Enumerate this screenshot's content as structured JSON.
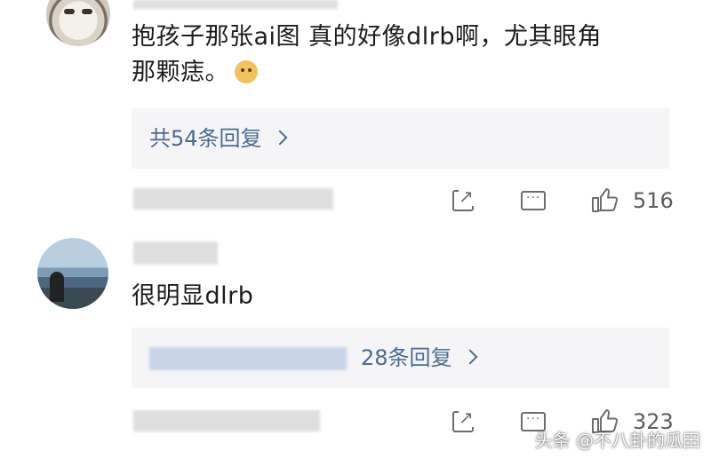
{
  "comments": [
    {
      "text": "抱孩子那张ai图 真的好像dlrb啊，尤其眼角",
      "text_line2": "那颗痣。",
      "emoji": "dog-emoji",
      "replies_label": "共54条回复",
      "like_count": "516"
    },
    {
      "text": "很明显dlrb",
      "replies_label": "28条回复",
      "like_count": "323"
    }
  ],
  "watermark": "头条 @不八卦的瓜田"
}
